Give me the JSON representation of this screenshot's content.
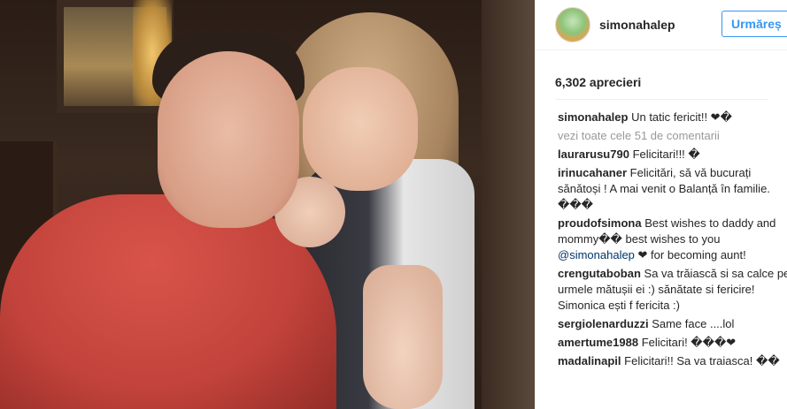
{
  "post": {
    "photo_alt": "Photo of a man in a red shirt and a blonde woman making a peace sign"
  },
  "header": {
    "username": "simonahalep",
    "follow_label": "Urmăreș",
    "avatar": "profile-avatar"
  },
  "likes": "6,302 aprecieri",
  "caption": {
    "user": "simonahalep",
    "text": "Un tatic fericit!! ❤�"
  },
  "view_all": "vezi toate cele 51 de comentarii",
  "comments": [
    {
      "user": "laurarusu790",
      "text": "Felicitari!!! �"
    },
    {
      "user": "irinucahaner",
      "text": "Felicitări, să vă bucurați sănătoși ! A mai venit o Balanță în familie. ���"
    },
    {
      "user": "proudofsimona",
      "text": "Best wishes to daddy and mommy�� best wishes to you",
      "mention": "@simonahalep",
      "after": "❤ for becoming aunt!"
    },
    {
      "user": "crengutaboban",
      "text": "Sa va trăiască si sa calce pe urmele mătușii ei :) sănătate si fericire! Simonica ești f fericita :)"
    },
    {
      "user": "sergiolenarduzzi",
      "text": "Same face ....lol"
    },
    {
      "user": "amertume1988",
      "text": "Felicitari! ���❤"
    },
    {
      "user": "madalinapil",
      "text": "Felicitari!! Sa va traiasca! ��"
    }
  ],
  "colors": {
    "accent": "#3897f0",
    "text": "#262626",
    "muted": "#999999",
    "border": "#efefef"
  }
}
